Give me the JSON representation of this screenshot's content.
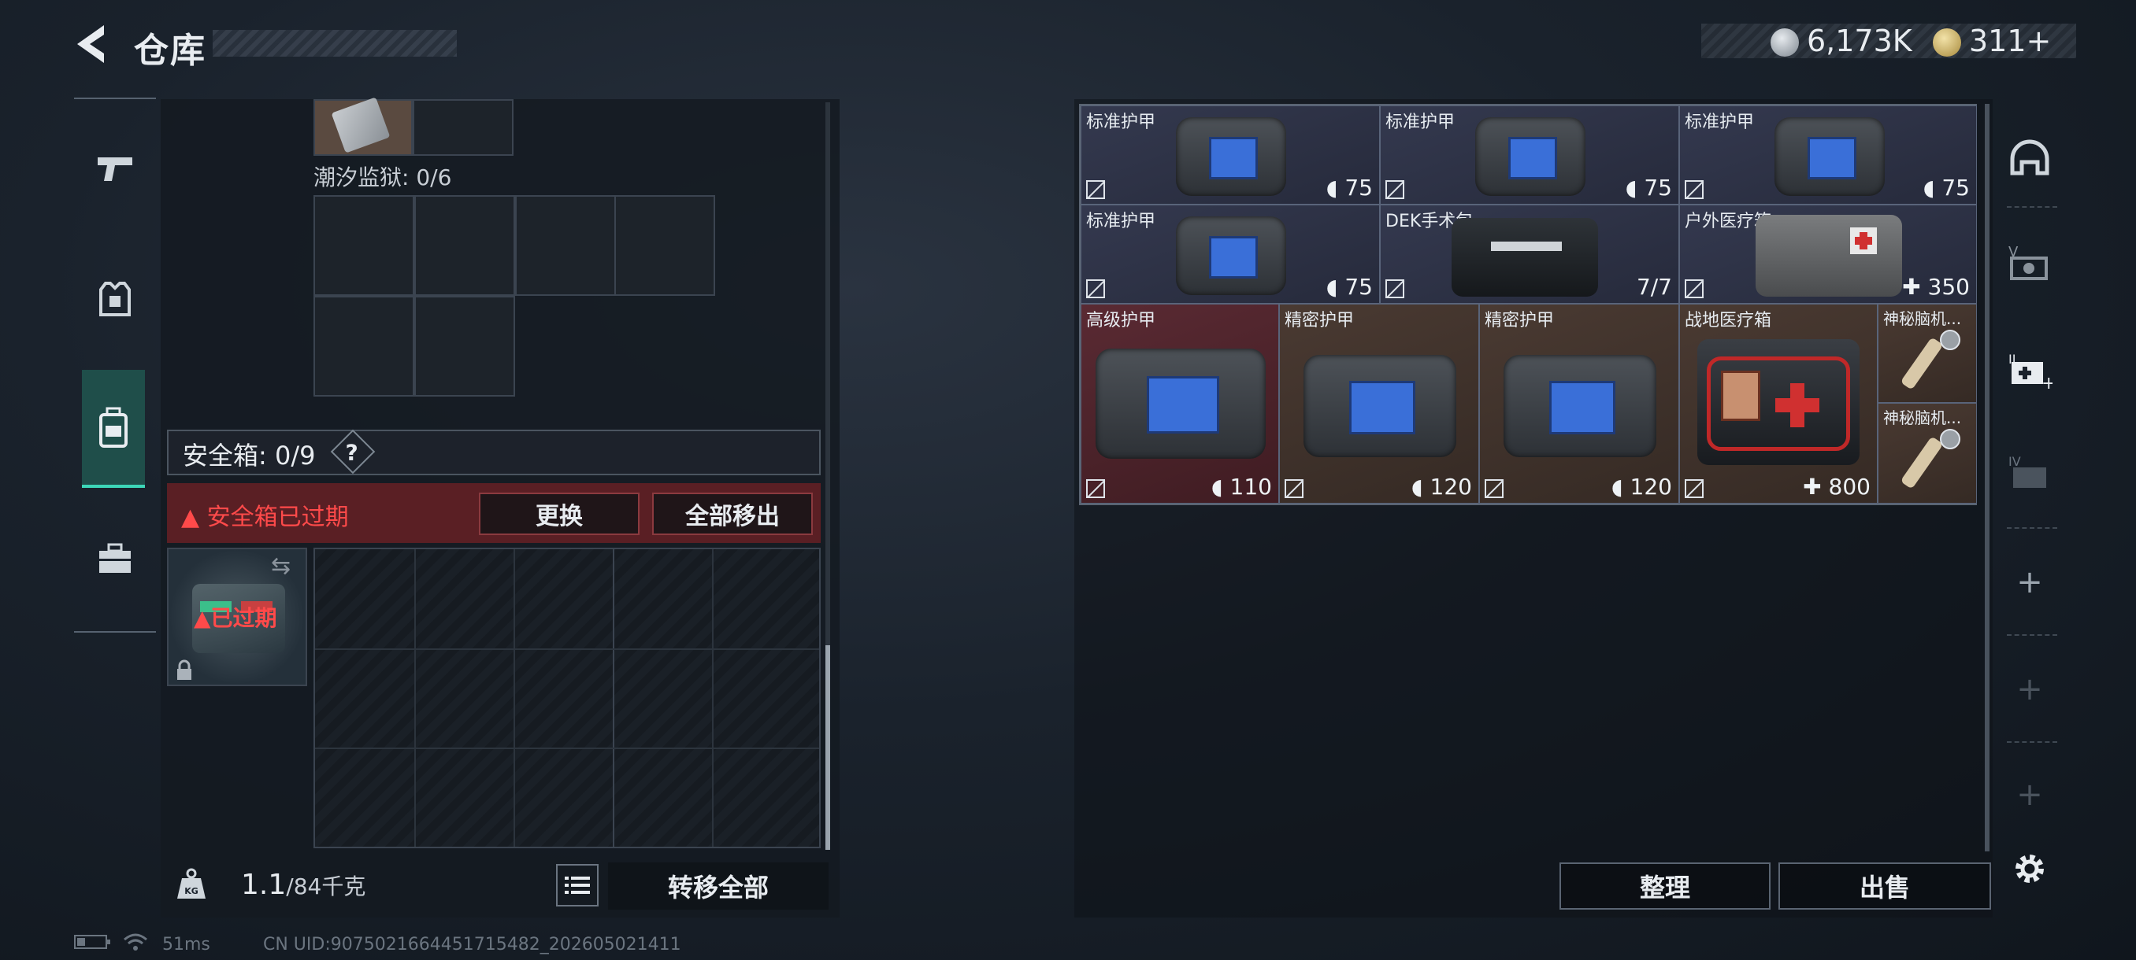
{
  "header": {
    "title": "仓库",
    "currency": [
      {
        "icon": "silver-coin-icon",
        "value": "6,173K"
      },
      {
        "icon": "gold-coin-icon",
        "value": "311+"
      }
    ]
  },
  "left_nav": [
    {
      "icon": "pistol-icon",
      "selected": false
    },
    {
      "icon": "armor-vest-icon",
      "selected": false
    },
    {
      "icon": "backpack-icon",
      "selected": true
    },
    {
      "icon": "toolbox-icon",
      "selected": false
    }
  ],
  "loadout": {
    "prison_label": "潮汐监狱: 0/6",
    "safebox_label": "安全箱: 0/9",
    "help_glyph": "?",
    "expired_warning": "安全箱已过期",
    "replace_button": "更换",
    "move_all_button": "全部移出",
    "expired_tag": "已过期",
    "weight_current": "1.1",
    "weight_max": "/84千克",
    "transfer_all_button": "转移全部"
  },
  "stash": {
    "items": [
      {
        "name": "标准护甲",
        "value": "75",
        "kind": "armor",
        "rarity": "blue"
      },
      {
        "name": "标准护甲",
        "value": "75",
        "kind": "armor",
        "rarity": "blue"
      },
      {
        "name": "标准护甲",
        "value": "75",
        "kind": "armor",
        "rarity": "blue"
      },
      {
        "name": "标准护甲",
        "value": "75",
        "kind": "armor",
        "rarity": "blue"
      },
      {
        "name": "DEK手术包",
        "value": "7/7",
        "kind": "surgery",
        "rarity": "blue"
      },
      {
        "name": "户外医疗箱",
        "value": "350",
        "kind": "medkit",
        "rarity": "blue"
      },
      {
        "name": "高级护甲",
        "value": "110",
        "kind": "armor",
        "rarity": "red"
      },
      {
        "name": "精密护甲",
        "value": "120",
        "kind": "armor",
        "rarity": "brown"
      },
      {
        "name": "精密护甲",
        "value": "120",
        "kind": "armor",
        "rarity": "brown"
      },
      {
        "name": "战地医疗箱",
        "value": "800",
        "kind": "medkit",
        "rarity": "brown"
      },
      {
        "name": "神秘脑机...",
        "value": "",
        "kind": "chip",
        "rarity": "brown"
      },
      {
        "name": "神秘脑机...",
        "value": "",
        "kind": "chip",
        "rarity": "brown"
      }
    ],
    "sort_button": "整理",
    "sell_button": "出售"
  },
  "right_rail": [
    {
      "icon": "helmet-icon"
    },
    {
      "icon": "v-container-icon"
    },
    {
      "icon": "medical-container-icon"
    },
    {
      "icon": "iv-container-icon"
    },
    {
      "icon": "plus-icon"
    },
    {
      "icon": "plus-icon"
    },
    {
      "icon": "plus-icon"
    },
    {
      "icon": "settings-gear-icon"
    }
  ],
  "status": {
    "ping": "51ms",
    "uid": "CN UID:9075021664451715482_202605021411"
  },
  "colors": {
    "accent": "#3dd6b8",
    "warning": "#ff4a4a",
    "rarity_blue": "#2c3146",
    "rarity_red": "#5a2a33",
    "rarity_brown": "#4a3a32"
  }
}
